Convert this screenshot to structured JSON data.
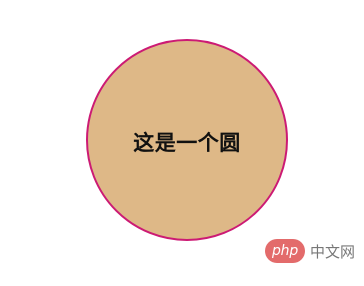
{
  "circle": {
    "label": "这是一个圆",
    "fill_color": "#deb887",
    "border_color": "#cc1a74"
  },
  "watermark": {
    "logo_text": "php",
    "site_text": "中文网",
    "logo_color": "#e36b6b"
  }
}
